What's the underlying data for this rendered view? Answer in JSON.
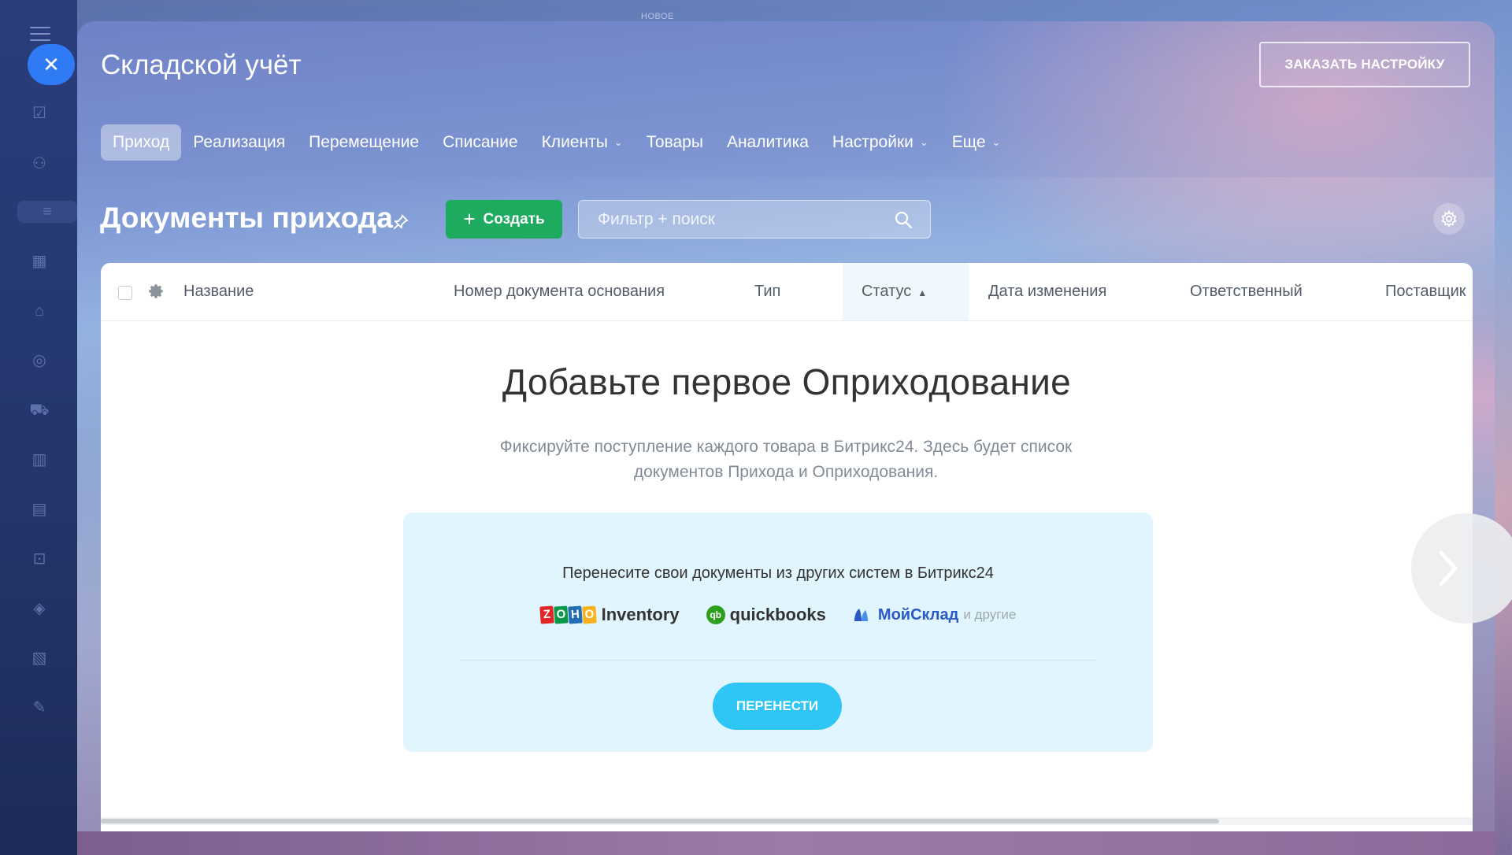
{
  "background": {
    "top_label": "НОВОЕ",
    "sidebar_icons": [
      "checkbox-icon",
      "people-icon",
      "funnel-icon",
      "calendar-icon",
      "warehouse-icon",
      "target-icon",
      "cart-icon",
      "chart-icon",
      "id-card-icon",
      "robot-icon",
      "box-icon",
      "document-icon",
      "pen-icon"
    ]
  },
  "app": {
    "title": "Складской учёт",
    "order_button": "ЗАКАЗАТЬ НАСТРОЙКУ"
  },
  "tabs": [
    {
      "label": "Приход",
      "active": true
    },
    {
      "label": "Реализация"
    },
    {
      "label": "Перемещение"
    },
    {
      "label": "Списание"
    },
    {
      "label": "Клиенты",
      "dropdown": true
    },
    {
      "label": "Товары"
    },
    {
      "label": "Аналитика"
    },
    {
      "label": "Настройки",
      "dropdown": true
    },
    {
      "label": "Еще",
      "dropdown": true
    }
  ],
  "toolbar": {
    "page_title": "Документы прихода",
    "create_label": "Создать",
    "search_placeholder": "Фильтр + поиск"
  },
  "grid": {
    "columns": [
      "Название",
      "Номер документа основания",
      "Тип",
      "Статус",
      "Дата изменения",
      "Ответственный",
      "Поставщик"
    ],
    "sorted_column": "Статус",
    "empty_title": "Добавьте первое Оприходование",
    "empty_desc_line1": "Фиксируйте поступление каждого товара в Битрикс24. Здесь будет список",
    "empty_desc_line2": "документов Прихода и Оприходования."
  },
  "migration": {
    "title": "Перенесите свои документы из других систем в Битрикс24",
    "zoho_letters": [
      "Z",
      "O",
      "H",
      "O"
    ],
    "zoho_colors": [
      "#e42527",
      "#089949",
      "#226db4",
      "#f9b21d"
    ],
    "inventory_label": "Inventory",
    "qb_mark": "qb",
    "qb_label": "quickbooks",
    "moysklad_label": "МойСклад",
    "others_label": "и другие",
    "button": "ПЕРЕНЕСТИ"
  },
  "colors": {
    "accent_green": "#1eaa5f",
    "accent_blue": "#2fc6f6",
    "close_blue": "#2f7bf5"
  }
}
